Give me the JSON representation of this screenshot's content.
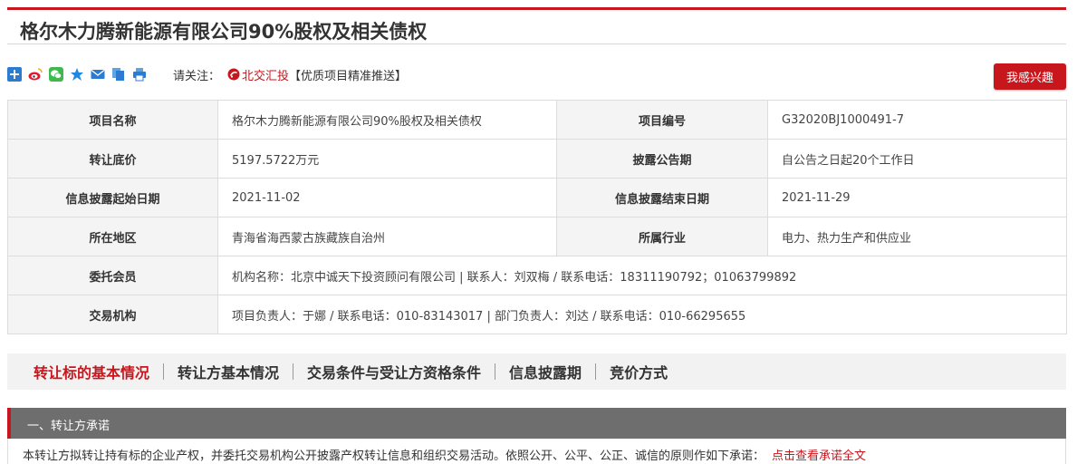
{
  "page": {
    "title": "格尔木力腾新能源有限公司90%股权及相关债权"
  },
  "share": {
    "icons": [
      "plus-icon",
      "weibo-icon",
      "wechat-icon",
      "qzone-icon",
      "mail-icon",
      "copy-icon",
      "print-icon"
    ],
    "follow_label": "请关注：",
    "follow_link": "北交汇投",
    "follow_promo": "【优质项目精准推送】"
  },
  "interest_button": {
    "label": "我感兴趣"
  },
  "info": {
    "project_name_label": "项目名称",
    "project_name": "格尔木力腾新能源有限公司90%股权及相关债权",
    "project_no_label": "项目编号",
    "project_no": "G32020BJ1000491-7",
    "base_price_label": "转让底价",
    "base_price": "5197.5722万元",
    "disclosure_period_label": "披露公告期",
    "disclosure_period": "自公告之日起20个工作日",
    "start_date_label": "信息披露起始日期",
    "start_date": "2021-11-02",
    "end_date_label": "信息披露结束日期",
    "end_date": "2021-11-29",
    "region_label": "所在地区",
    "region": "青海省海西蒙古族藏族自治州",
    "industry_label": "所属行业",
    "industry": "电力、热力生产和供应业",
    "member_label": "委托会员",
    "member": "机构名称：北京中诚天下投资顾问有限公司 | 联系人：刘双梅 / 联系电话：18311190792；01063799892",
    "exchange_label": "交易机构",
    "exchange": "项目负责人：于娜 / 联系电话：010-83143017 | 部门负责人：刘达 / 联系电话：010-66295655"
  },
  "tabs": [
    {
      "label": "转让标的基本情况",
      "active": true
    },
    {
      "label": "转让方基本情况",
      "active": false
    },
    {
      "label": "交易条件与受让方资格条件",
      "active": false
    },
    {
      "label": "信息披露期",
      "active": false
    },
    {
      "label": "竞价方式",
      "active": false
    }
  ],
  "section": {
    "title": "一、转让方承诺",
    "text": "本转让方拟转让持有标的企业产权，并委托交易机构公开披露产权转让信息和组织交易活动。依照公开、公平、公正、诚信的原则作如下承诺：",
    "link": "点击查看承诺全文"
  },
  "colors": {
    "accent": "#c8161d",
    "label_bg": "#f4f4f4",
    "tab_bg": "#f2f2f2",
    "section_bg": "#6e6e6e"
  }
}
